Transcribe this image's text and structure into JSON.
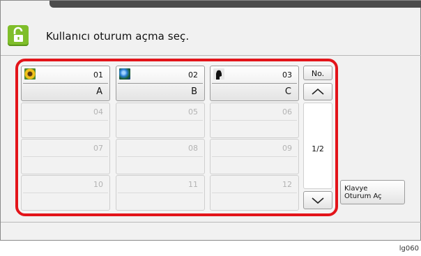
{
  "header": {
    "title": "Kullanıcı oturum açma seç."
  },
  "users": [
    {
      "num": "01",
      "name": "A",
      "icon": "sunflower-icon"
    },
    {
      "num": "02",
      "name": "B",
      "icon": "globe-icon"
    },
    {
      "num": "03",
      "name": "C",
      "icon": "silhouette-icon"
    },
    {
      "num": "04",
      "name": ""
    },
    {
      "num": "05",
      "name": ""
    },
    {
      "num": "06",
      "name": ""
    },
    {
      "num": "07",
      "name": ""
    },
    {
      "num": "08",
      "name": ""
    },
    {
      "num": "09",
      "name": ""
    },
    {
      "num": "10",
      "name": ""
    },
    {
      "num": "11",
      "name": ""
    },
    {
      "num": "12",
      "name": ""
    }
  ],
  "nav": {
    "no_label": "No.",
    "page_indicator": "1/2",
    "up_icon": "chevron-up-icon",
    "down_icon": "chevron-down-icon"
  },
  "keyboard_login": {
    "line1": "Klavye",
    "line2": "Oturum Aç"
  },
  "image_code": "lg060",
  "colors": {
    "frame_red": "#e3141a",
    "lock_green": "#7fbe2a",
    "top_bar": "#4c4c4c"
  }
}
